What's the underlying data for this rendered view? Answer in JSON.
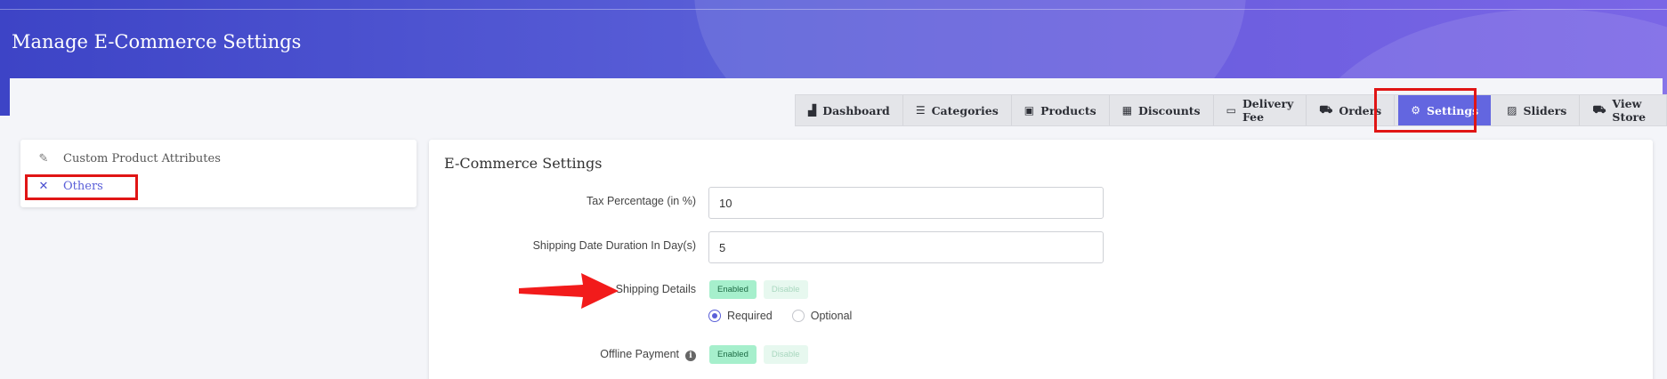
{
  "header": {
    "title": "Manage E-Commerce Settings"
  },
  "nav": {
    "items": [
      {
        "label": "Dashboard",
        "icon": "chart-icon",
        "glyph": "📈",
        "active": false
      },
      {
        "label": "Categories",
        "icon": "list-icon",
        "glyph": "☰",
        "active": false
      },
      {
        "label": "Products",
        "icon": "briefcase-icon",
        "glyph": "▤",
        "active": false
      },
      {
        "label": "Discounts",
        "icon": "gift-icon",
        "glyph": "🎁",
        "active": false
      },
      {
        "label": "Delivery Fee",
        "icon": "money-icon",
        "glyph": "▣",
        "active": false
      },
      {
        "label": "Orders",
        "icon": "cart-icon",
        "glyph": "🛒",
        "active": false
      },
      {
        "label": "Settings",
        "icon": "gear-icon",
        "glyph": "⚙",
        "active": true
      },
      {
        "label": "Sliders",
        "icon": "image-icon",
        "glyph": "▨",
        "active": false
      },
      {
        "label": "View Store",
        "icon": "cart-icon",
        "glyph": "🛒",
        "active": false
      }
    ]
  },
  "sidebar": {
    "items": [
      {
        "label": "Custom Product Attributes",
        "icon": "edit-icon",
        "glyph": "✎",
        "active": false
      },
      {
        "label": "Others",
        "icon": "tools-icon",
        "glyph": "✕",
        "active": true
      }
    ]
  },
  "settings": {
    "title": "E-Commerce Settings",
    "tax": {
      "label": "Tax Percentage (in %)",
      "value": "10"
    },
    "shipping_duration": {
      "label": "Shipping Date Duration In Day(s)",
      "value": "5"
    },
    "shipping_details": {
      "label": "Shipping Details",
      "enabled_label": "Enabled",
      "disable_label": "Disable",
      "state": "enabled",
      "options": [
        {
          "label": "Required",
          "selected": true
        },
        {
          "label": "Optional",
          "selected": false
        }
      ]
    },
    "offline_payment": {
      "label": "Offline Payment",
      "info_glyph": "i",
      "enabled_label": "Enabled",
      "disable_label": "Disable",
      "state": "enabled"
    }
  },
  "colors": {
    "accent": "#6366e0",
    "highlight": "#e01515",
    "enabled": "#a6efcc"
  }
}
